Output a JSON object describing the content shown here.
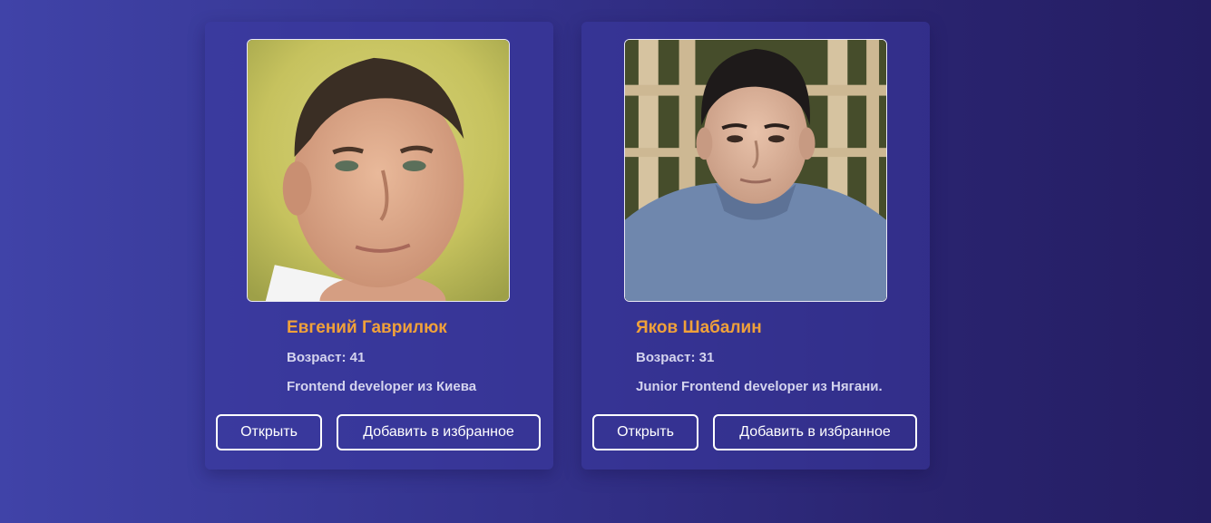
{
  "profiles": [
    {
      "photo_alt": "Евгений Гаврилюк",
      "name": "Евгений Гаврилюк",
      "age": "Возраст: 41",
      "role": "Frontend developer из Киева",
      "open_label": "Открыть",
      "favorite_label": "Добавить в избранное"
    },
    {
      "photo_alt": "Яков Шабалин",
      "name": "Яков Шабалин",
      "age": "Возраст: 31",
      "role": "Junior Frontend developer из Нягани.",
      "open_label": "Открыть",
      "favorite_label": "Добавить в избранное"
    }
  ],
  "colors": {
    "name_accent": "#f0a13a",
    "button_border": "#ffffff",
    "background_start": "#4043a8",
    "background_end": "#241d62"
  }
}
